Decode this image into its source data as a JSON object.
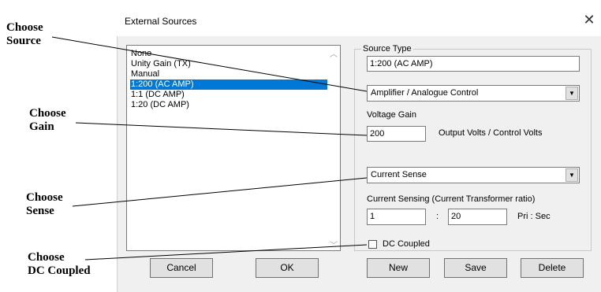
{
  "callouts": {
    "source": [
      "Choose",
      "Source"
    ],
    "gain": [
      "Choose",
      "Gain"
    ],
    "sense": [
      "Choose",
      "Sense"
    ],
    "dc": [
      "Choose",
      "DC Coupled"
    ]
  },
  "dialog": {
    "title": "External Sources",
    "close_glyph": "✕"
  },
  "list": {
    "items": [
      "None",
      "Unity Gain (TX)",
      "Manual",
      "1:200 (AC AMP)",
      "1:1 (DC AMP)",
      "1:20 (DC AMP)"
    ],
    "selected_index": 3
  },
  "source_type": {
    "group_label": "Source Type",
    "name_value": "1:200 (AC AMP)",
    "control_value": "Amplifier / Analogue Control"
  },
  "gain": {
    "label": "Voltage Gain",
    "value": "200",
    "units": "Output Volts / Control Volts"
  },
  "sense": {
    "mode_value": "Current Sense",
    "ratio_label": "Current Sensing (Current Transformer ratio)",
    "primary": "1",
    "separator": ":",
    "secondary": "20",
    "units": "Pri : Sec"
  },
  "dc_coupled": {
    "label": "DC Coupled",
    "checked": false
  },
  "buttons": {
    "cancel": "Cancel",
    "ok": "OK",
    "new": "New",
    "save": "Save",
    "delete": "Delete"
  },
  "icons": {
    "combo_arrow": "chevron-down-icon",
    "scroll_up": "scroll-up-icon",
    "scroll_down": "scroll-down-icon"
  }
}
